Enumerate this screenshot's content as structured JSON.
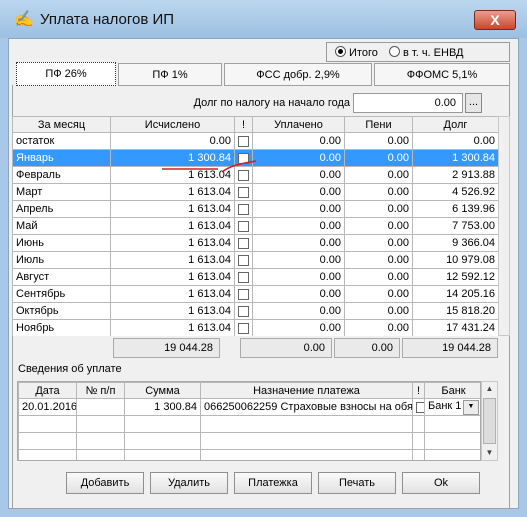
{
  "window": {
    "title": "Уплата налогов ИП",
    "close_label": "X"
  },
  "radio": {
    "options": [
      "Итого",
      "в т. ч. ЕНВД"
    ],
    "selected": "Итого"
  },
  "tabs": [
    "ПФ 26%",
    "ПФ 1%",
    "ФСС добр. 2,9%",
    "ФФОМС 5,1%"
  ],
  "active_tab": "ПФ 26%",
  "debt": {
    "label": "Долг по налогу на начало года",
    "value": "0.00",
    "button_label": "..."
  },
  "main_table": {
    "headers": [
      "За месяц",
      "Исчислено",
      "!",
      "Уплачено",
      "Пени",
      "Долг"
    ],
    "rows": [
      {
        "month": "остаток",
        "calc": "0.00",
        "paid": "0.00",
        "penalty": "0.00",
        "debt": "0.00"
      },
      {
        "month": "Январь",
        "calc": "1 300.84",
        "paid": "0.00",
        "penalty": "0.00",
        "debt": "1 300.84"
      },
      {
        "month": "Февраль",
        "calc": "1 613.04",
        "paid": "0.00",
        "penalty": "0.00",
        "debt": "2 913.88"
      },
      {
        "month": "Март",
        "calc": "1 613.04",
        "paid": "0.00",
        "penalty": "0.00",
        "debt": "4 526.92"
      },
      {
        "month": "Апрель",
        "calc": "1 613.04",
        "paid": "0.00",
        "penalty": "0.00",
        "debt": "6 139.96"
      },
      {
        "month": "Май",
        "calc": "1 613.04",
        "paid": "0.00",
        "penalty": "0.00",
        "debt": "7 753.00"
      },
      {
        "month": "Июнь",
        "calc": "1 613.04",
        "paid": "0.00",
        "penalty": "0.00",
        "debt": "9 366.04"
      },
      {
        "month": "Июль",
        "calc": "1 613.04",
        "paid": "0.00",
        "penalty": "0.00",
        "debt": "10 979.08"
      },
      {
        "month": "Август",
        "calc": "1 613.04",
        "paid": "0.00",
        "penalty": "0.00",
        "debt": "12 592.12"
      },
      {
        "month": "Сентябрь",
        "calc": "1 613.04",
        "paid": "0.00",
        "penalty": "0.00",
        "debt": "14 205.16"
      },
      {
        "month": "Октябрь",
        "calc": "1 613.04",
        "paid": "0.00",
        "penalty": "0.00",
        "debt": "15 818.20"
      },
      {
        "month": "Ноябрь",
        "calc": "1 613.04",
        "paid": "0.00",
        "penalty": "0.00",
        "debt": "17 431.24"
      }
    ],
    "selected_row": "Январь",
    "totals": {
      "calc": "19 044.28",
      "paid": "0.00",
      "penalty": "0.00",
      "debt": "19 044.28"
    }
  },
  "payments": {
    "label": "Сведения об уплате",
    "headers": [
      "Дата",
      "№ п/п",
      "Сумма",
      "Назначение платежа",
      "!",
      "Банк"
    ],
    "rows": [
      {
        "date": "20.01.2016",
        "num": "",
        "amount": "1 300.84",
        "purpose": "066250062259 Страховые взносы на обя",
        "bank": "Банк 1"
      }
    ]
  },
  "buttons": [
    "Добавить",
    "Удалить",
    "Платежка",
    "Печать",
    "Ok"
  ],
  "colors": {
    "selection": "#3399ff",
    "title_bar": "#9cc0e2",
    "close_button": "#c9452d",
    "annotation_mark": "#d0202a"
  }
}
